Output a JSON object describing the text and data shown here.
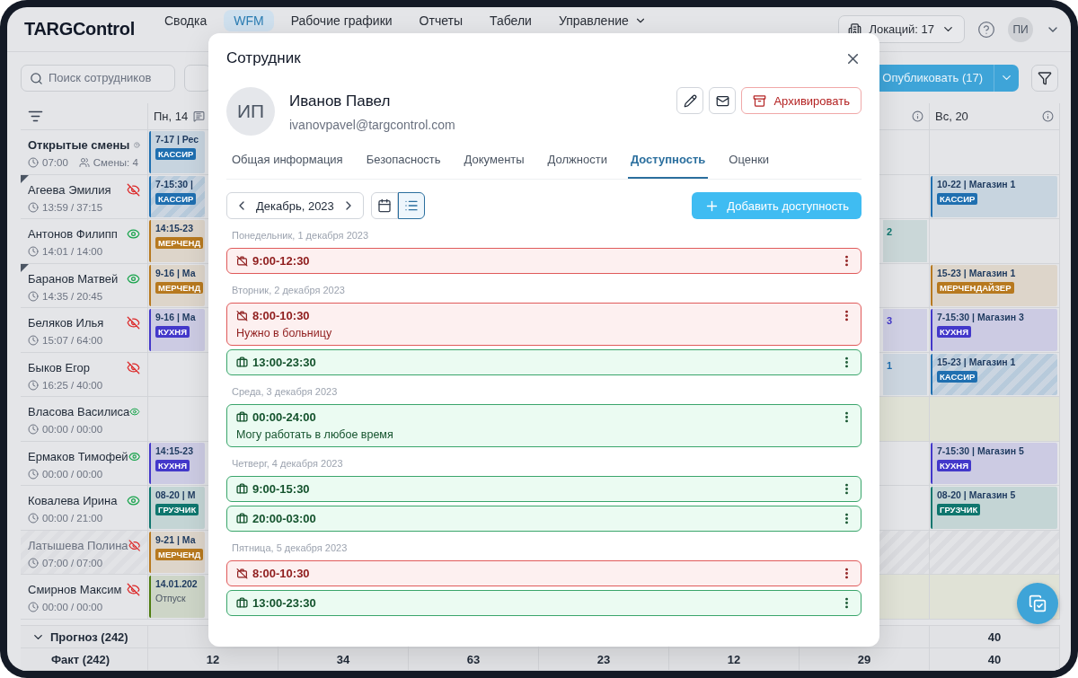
{
  "header": {
    "logo": "TARGControl",
    "nav": [
      {
        "label": "Сводка",
        "selected": false,
        "dropdown": false
      },
      {
        "label": "WFM",
        "selected": true,
        "dropdown": false
      },
      {
        "label": "Рабочие графики",
        "selected": false,
        "dropdown": false
      },
      {
        "label": "Отчеты",
        "selected": false,
        "dropdown": false
      },
      {
        "label": "Табели",
        "selected": false,
        "dropdown": false
      },
      {
        "label": "Управление",
        "selected": false,
        "dropdown": true
      }
    ],
    "locations": "Локаций: 17",
    "avatar": "ПИ"
  },
  "toolbar": {
    "search": {
      "placeholder": "Поиск сотрудников"
    },
    "publish": "Опубликовать (17)"
  },
  "schedule": {
    "open_shifts": {
      "title": "Открытые смены",
      "time": "07:00",
      "count": "Смены: 4"
    },
    "employees": [
      {
        "name": "Агеева Эмилия",
        "hours": "13:59 / 37:15",
        "visible": false,
        "flagged": true,
        "dimmed": false
      },
      {
        "name": "Антонов Филипп",
        "hours": "14:01 / 14:00",
        "visible": true,
        "flagged": false,
        "dimmed": false
      },
      {
        "name": "Баранов Матвей",
        "hours": "14:35 / 20:45",
        "visible": true,
        "flagged": true,
        "dimmed": false
      },
      {
        "name": "Беляков Илья",
        "hours": "15:07 / 64:00",
        "visible": false,
        "flagged": false,
        "dimmed": false
      },
      {
        "name": "Быков Егор",
        "hours": "16:25 / 40:00",
        "visible": false,
        "flagged": false,
        "dimmed": false
      },
      {
        "name": "Власова Василиса",
        "hours": "00:00 / 00:00",
        "visible": true,
        "flagged": false,
        "dimmed": false
      },
      {
        "name": "Ермаков Тимофей",
        "hours": "00:00 / 00:00",
        "visible": true,
        "flagged": false,
        "dimmed": false
      },
      {
        "name": "Ковалева Ирина",
        "hours": "00:00 / 21:00",
        "visible": true,
        "flagged": false,
        "dimmed": false
      },
      {
        "name": "Латышева Полина",
        "hours": "07:00 / 07:00",
        "visible": false,
        "flagged": false,
        "dimmed": true
      },
      {
        "name": "Смирнов Максим",
        "hours": "00:00 / 00:00",
        "visible": false,
        "flagged": false,
        "dimmed": false
      }
    ],
    "columns": [
      {
        "label": "Пн, 14",
        "comment": true,
        "info": false,
        "cells": [
          {
            "kind": "shift",
            "time": "7-17 | Рес",
            "role": "КАССИР",
            "color": "#1f6fb0",
            "striped": false
          },
          {
            "kind": "shift",
            "time": "7-15:30 |",
            "role": "КАССИР",
            "color": "#1f6fb0",
            "striped": true
          },
          {
            "kind": "shift",
            "time": "14:15-23",
            "role": "МЕРЧЕНД",
            "color": "#b7791f",
            "striped": false
          },
          {
            "kind": "shift",
            "time": "9-16 | Ма",
            "role": "МЕРЧЕНД",
            "color": "#b7791f",
            "striped": false
          },
          {
            "kind": "shift",
            "time": "9-16 | Ма",
            "role": "КУХНЯ",
            "color": "#4338ca",
            "striped": false
          },
          {
            "kind": "empty"
          },
          {
            "kind": "empty"
          },
          {
            "kind": "shift",
            "time": "14:15-23",
            "role": "КУХНЯ",
            "color": "#4338ca",
            "striped": false
          },
          {
            "kind": "shift",
            "time": "08-20 | М",
            "role": "ГРУЗЧИК",
            "color": "#0f766e",
            "striped": false
          },
          {
            "kind": "shift",
            "time": "9-21 | Ма",
            "role": "МЕРЧЕНД",
            "color": "#b7791f",
            "striped": false
          },
          {
            "kind": "note",
            "time": "14.01.202",
            "note": "Отпуск",
            "color": "#4d7c0f"
          }
        ]
      },
      {
        "comment": false,
        "info": true,
        "cells": [
          {
            "kind": "empty"
          },
          {
            "kind": "empty"
          },
          {
            "kind": "fragment",
            "text": "2",
            "color": "#0f766e"
          },
          {
            "kind": "empty"
          },
          {
            "kind": "fragment",
            "text": "3",
            "color": "#4338ca"
          },
          {
            "kind": "fragment",
            "text": "1",
            "color": "#1f6fb0"
          },
          {
            "kind": "off"
          },
          {
            "kind": "empty"
          },
          {
            "kind": "empty"
          },
          {
            "kind": "hatched"
          },
          {
            "kind": "off"
          }
        ]
      },
      {
        "label": "Вс, 20",
        "comment": false,
        "info": true,
        "cells": [
          {
            "kind": "empty"
          },
          {
            "kind": "shift",
            "time": "10-22 | Магазин 1",
            "role": "КАССИР",
            "color": "#1f6fb0",
            "striped": false
          },
          {
            "kind": "empty"
          },
          {
            "kind": "shift",
            "time": "15-23 | Магазин 1",
            "role": "МЕРЧЕНДАЙЗЕР",
            "color": "#b7791f",
            "striped": false
          },
          {
            "kind": "shift",
            "time": "7-15:30 | Магазин 3",
            "role": "КУХНЯ",
            "color": "#4338ca",
            "striped": false
          },
          {
            "kind": "shift",
            "time": "15-23 | Магазин 1",
            "role": "КАССИР",
            "color": "#1f6fb0",
            "striped": true
          },
          {
            "kind": "off"
          },
          {
            "kind": "shift",
            "time": "7-15:30 | Магазин 5",
            "role": "КУХНЯ",
            "color": "#4338ca",
            "striped": false
          },
          {
            "kind": "shift",
            "time": "08-20 | Магазин 5",
            "role": "ГРУЗЧИК",
            "color": "#0f766e",
            "striped": false
          },
          {
            "kind": "hatched"
          },
          {
            "kind": "off"
          }
        ]
      }
    ],
    "forecast": {
      "label": "Прогноз (242)",
      "expanded": true,
      "column_7": "40"
    },
    "fact": {
      "label": "Факт (242)",
      "values": [
        "12",
        "34",
        "63",
        "23",
        "12",
        "29",
        "40"
      ]
    }
  },
  "modal": {
    "title": "Сотрудник",
    "avatar": "ИП",
    "name": "Иванов Павел",
    "email": "ivanovpavel@targcontrol.com",
    "archive": "Архивировать",
    "tabs": [
      {
        "label": "Общая информация",
        "selected": false
      },
      {
        "label": "Безопасность",
        "selected": false
      },
      {
        "label": "Документы",
        "selected": false
      },
      {
        "label": "Должности",
        "selected": false
      },
      {
        "label": "Доступность",
        "selected": true
      },
      {
        "label": "Оценки",
        "selected": false
      }
    ],
    "month": "Декабрь, 2023",
    "views": [
      {
        "kind": "calendar",
        "selected": false
      },
      {
        "kind": "list",
        "selected": true
      }
    ],
    "add": "Добавить доступность",
    "days": [
      {
        "label": "Понедельник, 1 декабря 2023",
        "slots": [
          {
            "kind": "unavailable",
            "time": "9:00-12:30"
          }
        ]
      },
      {
        "label": "Вторник, 2 декабря 2023",
        "slots": [
          {
            "kind": "unavailable",
            "time": "8:00-10:30",
            "note": "Нужно в больницу"
          },
          {
            "kind": "available",
            "time": "13:00-23:30"
          }
        ]
      },
      {
        "label": "Среда, 3 декабря 2023",
        "slots": [
          {
            "kind": "available",
            "time": "00:00-24:00",
            "note": "Могу работать в любое время"
          }
        ]
      },
      {
        "label": "Четверг, 4 декабря 2023",
        "slots": [
          {
            "kind": "available",
            "time": "9:00-15:30"
          },
          {
            "kind": "available",
            "time": "20:00-03:00"
          }
        ]
      },
      {
        "label": "Пятница, 5 декабря 2023",
        "slots": [
          {
            "kind": "unavailable",
            "time": "8:00-10:30"
          },
          {
            "kind": "available",
            "time": "13:00-23:30"
          }
        ]
      }
    ]
  }
}
